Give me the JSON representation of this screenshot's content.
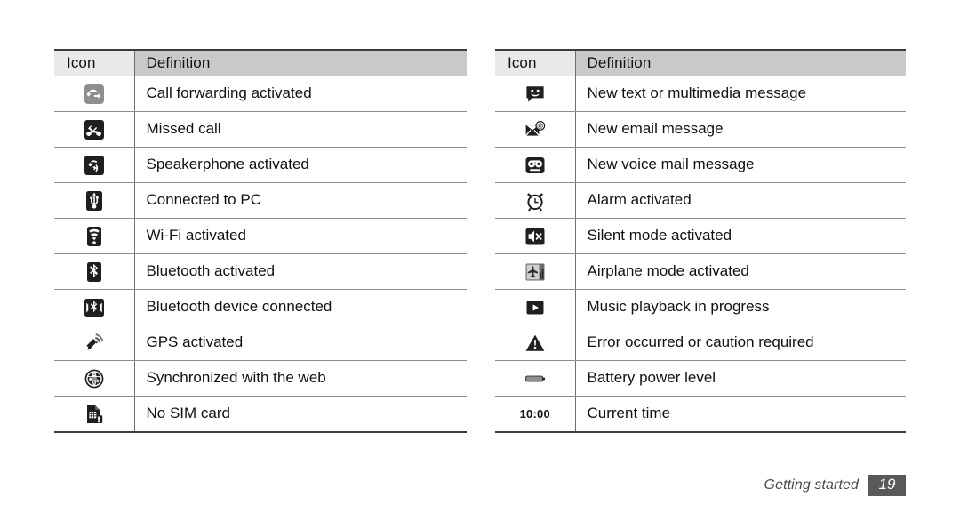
{
  "document": {
    "footer": {
      "section_label": "Getting started",
      "page_number": "19"
    },
    "colors": {
      "header_icon_bg": "#e9e9e9",
      "header_definition_bg": "#c9c9c9",
      "rule_dark": "#3c3c3c",
      "rule_light": "#8d8d8d",
      "page_badge_bg": "#595959",
      "text": "#111111"
    }
  },
  "tables": [
    {
      "id": "left",
      "columns": {
        "icon": "Icon",
        "definition": "Definition"
      },
      "rows": [
        {
          "icon": "call-forwarding-icon",
          "definition": "Call forwarding activated"
        },
        {
          "icon": "missed-call-icon",
          "definition": "Missed call"
        },
        {
          "icon": "speakerphone-icon",
          "definition": "Speakerphone activated"
        },
        {
          "icon": "usb-connected-icon",
          "definition": "Connected to PC"
        },
        {
          "icon": "wifi-icon",
          "definition": "Wi-Fi activated"
        },
        {
          "icon": "bluetooth-icon",
          "definition": "Bluetooth activated"
        },
        {
          "icon": "bluetooth-connected-icon",
          "definition": "Bluetooth device connected"
        },
        {
          "icon": "gps-icon",
          "definition": "GPS activated"
        },
        {
          "icon": "web-sync-icon",
          "definition": "Synchronized with the web"
        },
        {
          "icon": "no-sim-card-icon",
          "definition": "No SIM card"
        }
      ]
    },
    {
      "id": "right",
      "columns": {
        "icon": "Icon",
        "definition": "Definition"
      },
      "rows": [
        {
          "icon": "new-message-icon",
          "definition": "New text or multimedia message"
        },
        {
          "icon": "new-email-icon",
          "definition": "New email message"
        },
        {
          "icon": "voicemail-icon",
          "definition": "New voice mail message"
        },
        {
          "icon": "alarm-icon",
          "definition": "Alarm activated"
        },
        {
          "icon": "silent-mode-icon",
          "definition": "Silent mode activated"
        },
        {
          "icon": "airplane-mode-icon",
          "definition": "Airplane mode activated"
        },
        {
          "icon": "music-play-icon",
          "definition": "Music playback in progress"
        },
        {
          "icon": "warning-icon",
          "definition": "Error occurred or caution required"
        },
        {
          "icon": "battery-icon",
          "definition": "Battery power level"
        },
        {
          "icon": "current-time-text",
          "definition": "Current time",
          "icon_text": "10:00"
        }
      ]
    }
  ]
}
